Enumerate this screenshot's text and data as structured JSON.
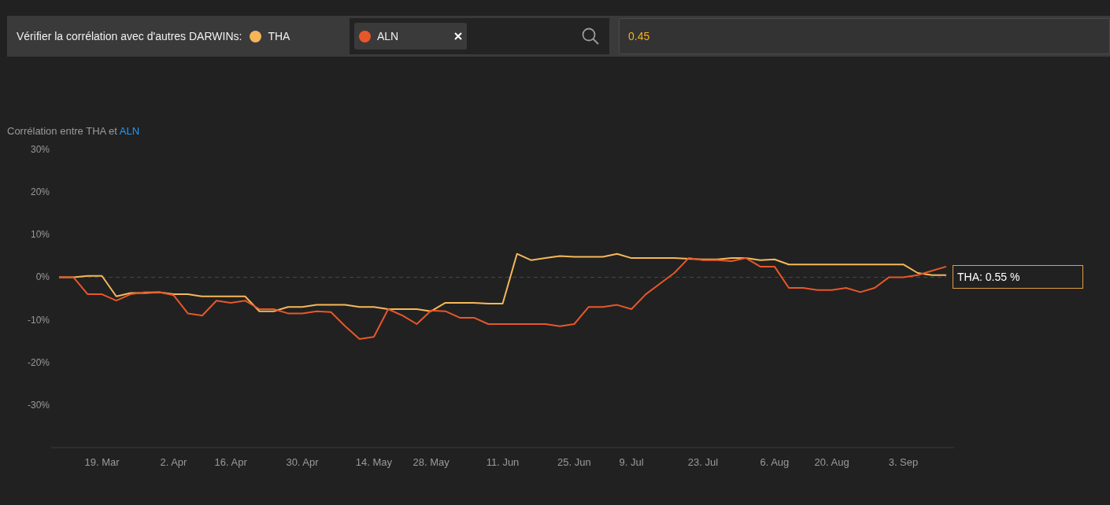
{
  "toolbar": {
    "label": "Vérifier la corrélation avec d'autres DARWINs:",
    "base": {
      "name": "THA",
      "color": "#f5b55a"
    },
    "selected_darwins": [
      {
        "name": "ALN",
        "color": "#e8572a"
      }
    ],
    "threshold_value": "0.45"
  },
  "chart": {
    "subtitle_prefix": "Corrélation entre",
    "subtitle_joiner": "et",
    "tooltip": "THA: 0.55 %",
    "chart_data": {
      "type": "line",
      "categories": [
        null,
        null,
        null,
        "19. Mar",
        null,
        null,
        null,
        null,
        "2. Apr",
        null,
        null,
        null,
        "16. Apr",
        null,
        null,
        null,
        null,
        "30. Apr",
        null,
        null,
        null,
        null,
        "14. May",
        null,
        null,
        null,
        "28. May",
        null,
        null,
        null,
        null,
        "11. Jun",
        null,
        null,
        null,
        null,
        "25. Jun",
        null,
        null,
        null,
        "9. Jul",
        null,
        null,
        null,
        null,
        "23. Jul",
        null,
        null,
        null,
        null,
        "6. Aug",
        null,
        null,
        null,
        "20. Aug",
        null,
        null,
        null,
        null,
        "3. Sep",
        null,
        null,
        null
      ],
      "series": [
        {
          "name": "THA",
          "color": "#f5b95a",
          "values": [
            0,
            0,
            0.3,
            0.3,
            -4.5,
            -3.7,
            -3.7,
            -3.5,
            -4,
            -4,
            -4.5,
            -4.5,
            -4.5,
            -4.5,
            -8,
            -8,
            -7,
            -7,
            -6.5,
            -6.5,
            -6.5,
            -7,
            -7,
            -7.5,
            -7.5,
            -7.5,
            -8,
            -6,
            -6,
            -6,
            -6.2,
            -6.2,
            5.5,
            4,
            4.5,
            5,
            4.8,
            4.8,
            4.8,
            5.5,
            4.5,
            4.5,
            4.5,
            4.5,
            4.3,
            4.2,
            4.2,
            4.5,
            4.5,
            4,
            4.2,
            3,
            3,
            3,
            3,
            3,
            3,
            3,
            3,
            3,
            1,
            0.5,
            0.5
          ]
        },
        {
          "name": "ALN",
          "color": "#e8572a",
          "values": [
            0,
            0,
            -4,
            -4,
            -5.5,
            -4,
            -3.5,
            -3.5,
            -4.2,
            -8.5,
            -9,
            -5.5,
            -6,
            -5.5,
            -7.5,
            -7.5,
            -8.5,
            -8.5,
            -8,
            -8.2,
            -11.5,
            -14.5,
            -14,
            -7.5,
            -9,
            -11,
            -7.8,
            -8,
            -9.5,
            -9.5,
            -11,
            -11,
            -11,
            -11,
            -11,
            -11.5,
            -11,
            -7,
            -7,
            -6.5,
            -7.5,
            -4,
            -1.5,
            1,
            4.5,
            4,
            4,
            3.8,
            4.5,
            2.5,
            2.5,
            -2.5,
            -2.5,
            -3,
            -3,
            -2.5,
            -3.5,
            -2.5,
            0,
            0,
            0.5,
            1.5,
            2.5
          ]
        }
      ],
      "ylim": [
        -40,
        30
      ],
      "yticks": [
        {
          "value": 30,
          "label": "30%"
        },
        {
          "value": 20,
          "label": "20%"
        },
        {
          "value": 10,
          "label": "10%"
        },
        {
          "value": 0,
          "label": "0%"
        },
        {
          "value": -10,
          "label": "-10%"
        },
        {
          "value": -20,
          "label": "-20%"
        },
        {
          "value": -30,
          "label": "-30%"
        }
      ]
    }
  }
}
